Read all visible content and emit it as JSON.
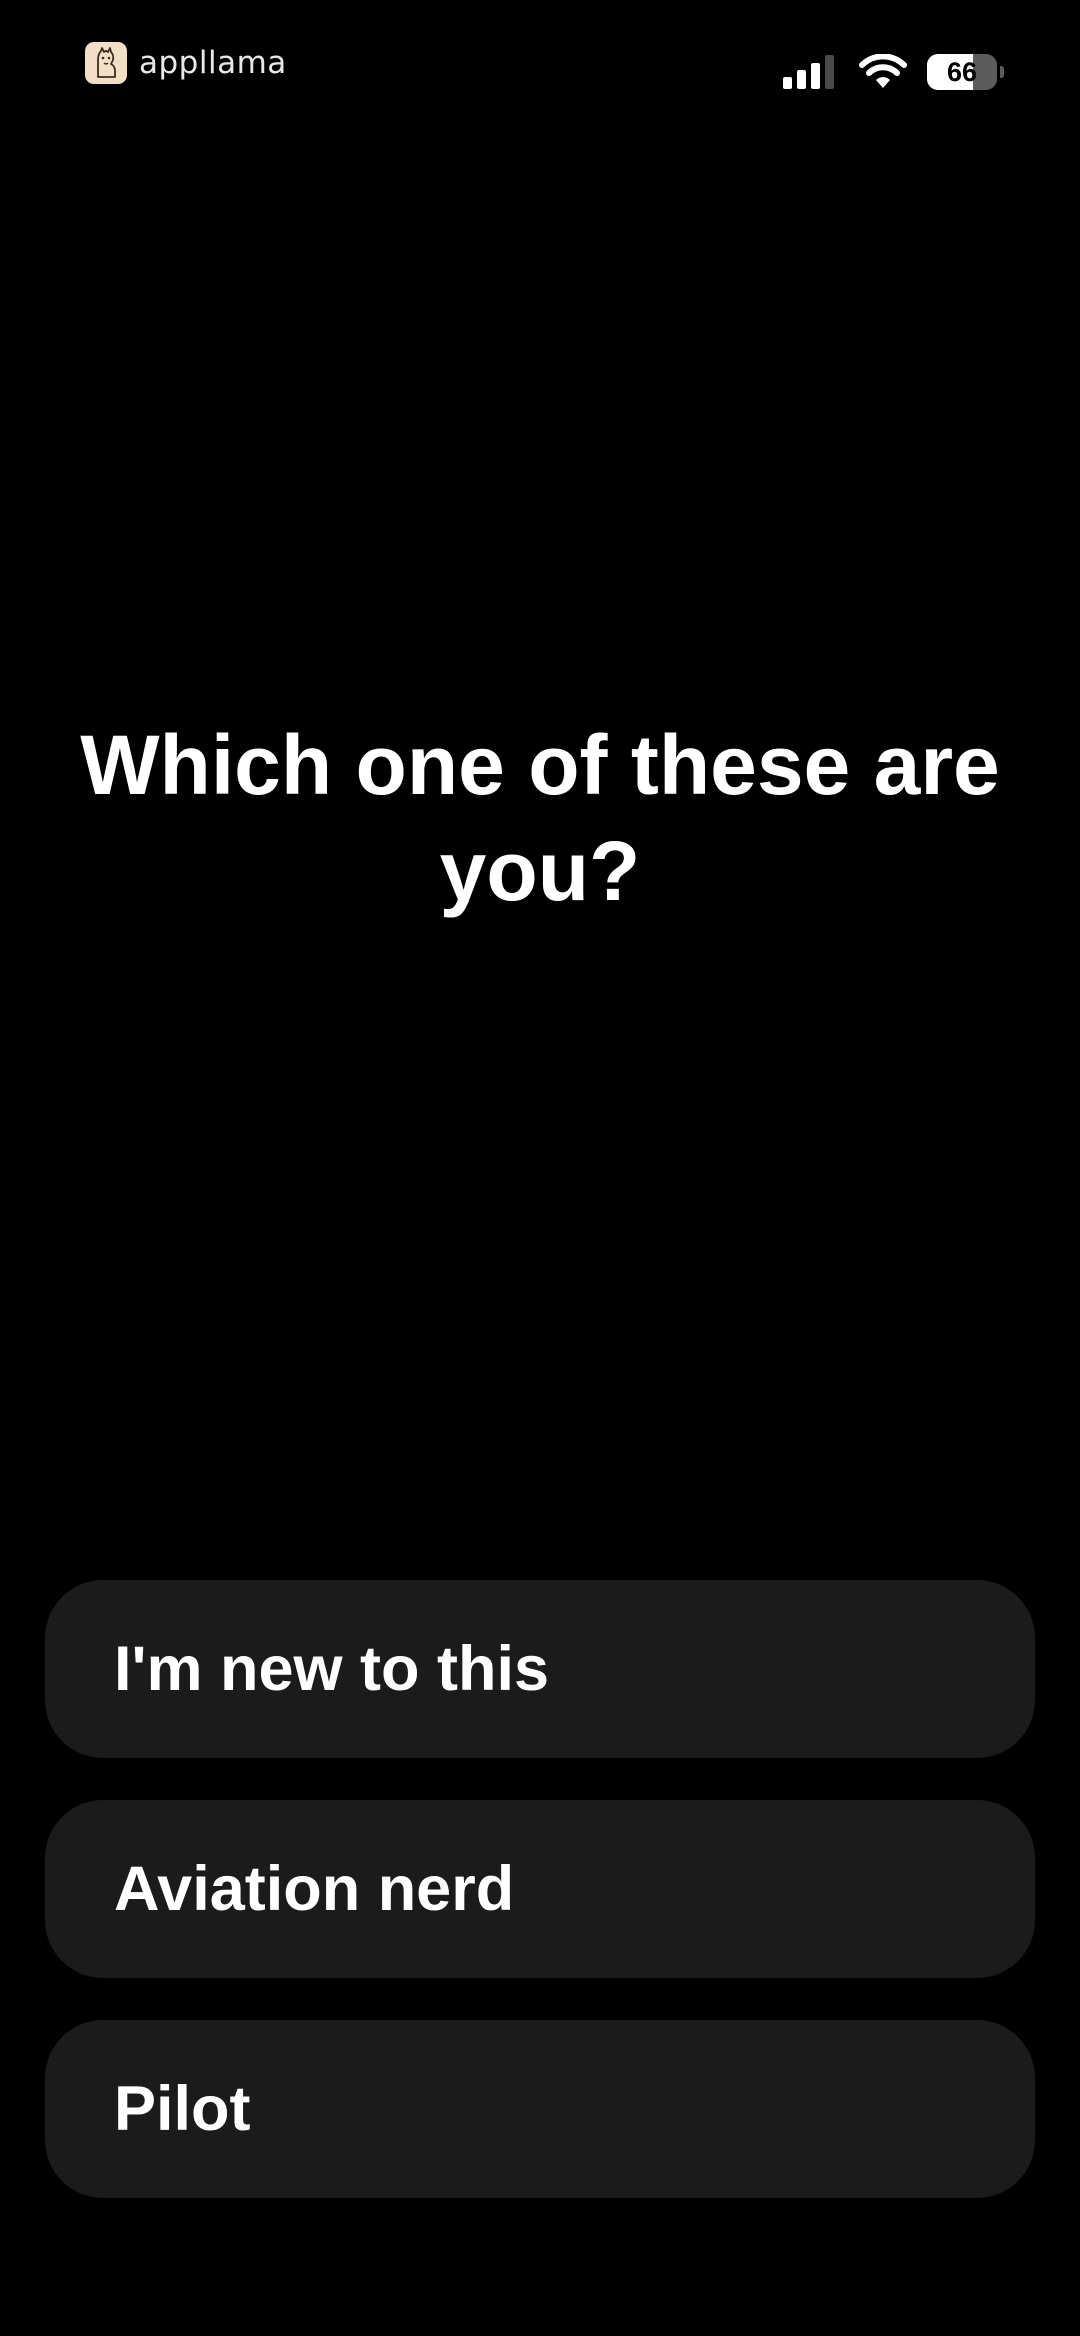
{
  "status_bar": {
    "brand_name": "appllama",
    "brand_icon": "llama-logo-icon",
    "signal_icon": "cellular-signal-icon",
    "wifi_icon": "wifi-icon",
    "battery_level": "66",
    "battery_fraction": 0.66
  },
  "question": {
    "title": "Which one of these are you?"
  },
  "options": [
    {
      "label": "I'm new to this"
    },
    {
      "label": "Aviation nerd"
    },
    {
      "label": "Pilot"
    }
  ],
  "colors": {
    "background": "#000000",
    "option_background": "#1b1b1b",
    "text": "#ffffff",
    "logo_background": "#f3dfc6"
  }
}
